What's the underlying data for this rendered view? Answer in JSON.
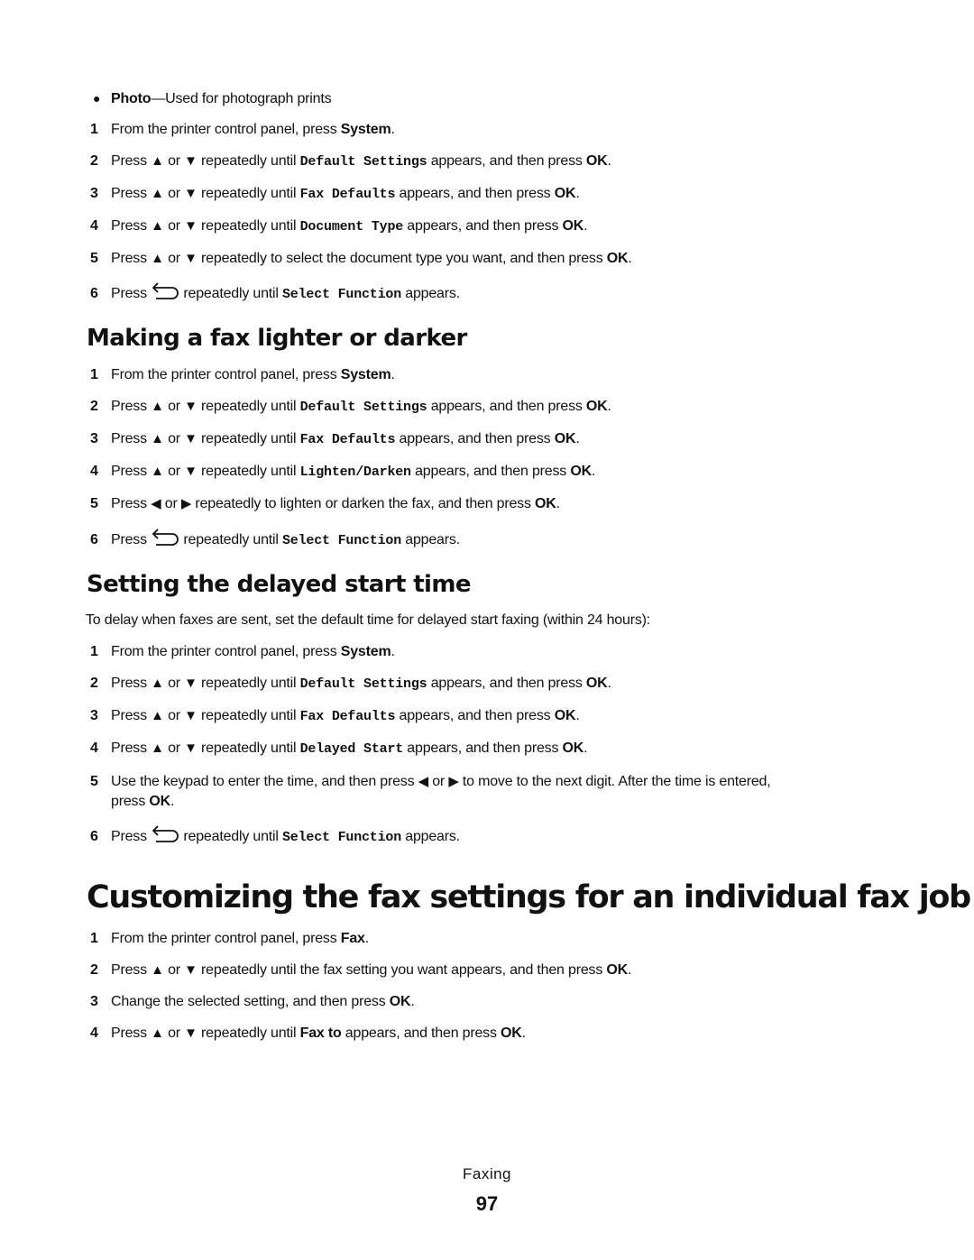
{
  "bullet_item": {
    "term": "Photo",
    "desc": "—Used for photograph prints"
  },
  "common": {
    "press": "Press",
    "or": "or",
    "repeatedly_until": "repeatedly until",
    "appears_then_ok": "appears, and then press",
    "ok": "OK",
    "appears": "appears.",
    "from_panel": "From the printer control panel, press",
    "system": "System",
    "default_settings": "Default Settings",
    "fax_defaults": "Fax Defaults",
    "select_function": "Select Function",
    "icons": {
      "up": "▲",
      "down": "▼",
      "left": "◀",
      "right": "▶",
      "back": "back-arrow-icon"
    }
  },
  "section1": {
    "step4_code": "Document Type",
    "step5_text": "repeatedly to select the document type you want, and then press"
  },
  "section2": {
    "title": "Making a fax lighter or darker",
    "step4_code": "Lighten/Darken",
    "step5_text": "repeatedly to lighten or darken the fax, and then press"
  },
  "section3": {
    "title": "Setting the delayed start time",
    "intro": "To delay when faxes are sent, set the default time for delayed start faxing (within 24 hours):",
    "step4_code": "Delayed Start",
    "step5_a": "Use the keypad to enter the time, and then press",
    "step5_b": "to move to the next digit. After the time is entered,",
    "step5_c": "press"
  },
  "section4": {
    "title": "Customizing the fax settings for an individual fax job",
    "step1_key": "Fax",
    "step2_text": "repeatedly until the fax setting you want appears, and then press",
    "step3_text": "Change the selected setting, and then press",
    "step4_key": "Fax to",
    "step4_text": "appears, and then press"
  },
  "footer": {
    "section": "Faxing",
    "page_number": "97"
  },
  "step_numbers": [
    "1",
    "2",
    "3",
    "4",
    "5",
    "6"
  ]
}
